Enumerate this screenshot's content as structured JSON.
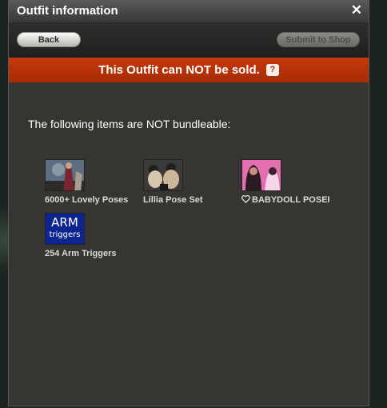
{
  "window": {
    "title": "Outfit information",
    "close_glyph": "✕"
  },
  "toolbar": {
    "back_label": "Back",
    "submit_label": "Submit to Shop"
  },
  "alert": {
    "message": "This Outfit can NOT be sold.",
    "help_glyph": "?"
  },
  "content": {
    "intro": "The following items are NOT bundleable:",
    "items": [
      {
        "label": "6000+ Lovely Poses",
        "thumb_colors": [
          "#5b6f80",
          "#7a2430",
          "#a89c90"
        ]
      },
      {
        "label": "Lillia Pose Set",
        "thumb_colors": [
          "#3c3a38",
          "#d6c6ae",
          "#211f1e"
        ]
      },
      {
        "label": "BABYDOLL POSER",
        "thumb_colors": [
          "#e46fb0",
          "#2a1a22",
          "#f6d6e8"
        ],
        "icon": "heart-icon"
      },
      {
        "label": "254 Arm Triggers",
        "thumb_text": [
          "ARM",
          "triggers"
        ],
        "thumb_colors": [
          "#0c2590"
        ]
      }
    ]
  },
  "colors": {
    "alert_red": "#b8320a",
    "panel_bg": "#363532",
    "titlebar": "#4a4a4a"
  }
}
